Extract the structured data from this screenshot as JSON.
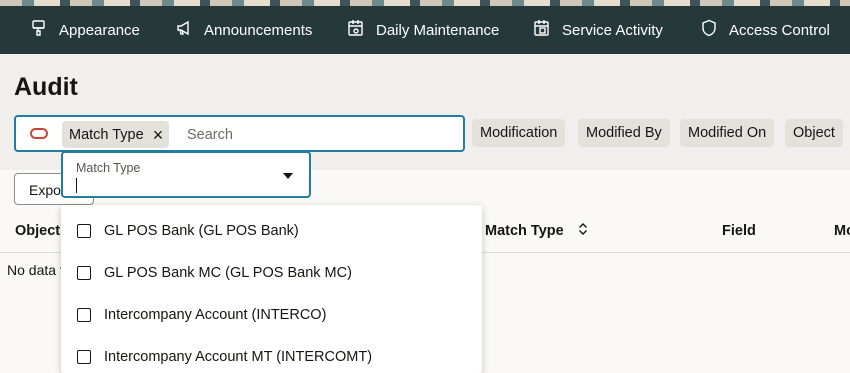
{
  "nav": {
    "items": [
      {
        "label": "Appearance",
        "icon": "brush-icon"
      },
      {
        "label": "Announcements",
        "icon": "megaphone-icon"
      },
      {
        "label": "Daily Maintenance",
        "icon": "calendar-gear-icon"
      },
      {
        "label": "Service Activity",
        "icon": "calendar-clipboard-icon"
      },
      {
        "label": "Access Control",
        "icon": "shield-icon"
      }
    ]
  },
  "page": {
    "title": "Audit"
  },
  "search": {
    "chip_label": "Match Type",
    "chip_remove": "×",
    "placeholder": "Search",
    "value": ""
  },
  "filters": {
    "pills": [
      "Modification",
      "Modified By",
      "Modified On",
      "Object"
    ]
  },
  "toolbar": {
    "export_label": "Export"
  },
  "table": {
    "headers": [
      "Object",
      "Match Type",
      "Field",
      "Mo"
    ],
    "empty_text": "No data to display."
  },
  "dropdown": {
    "label": "Match Type",
    "value": "",
    "options": [
      {
        "label": "GL POS Bank (GL POS Bank)",
        "checked": false
      },
      {
        "label": "GL POS Bank MC (GL POS Bank MC)",
        "checked": false
      },
      {
        "label": "Intercompany Account (INTERCO)",
        "checked": false
      },
      {
        "label": "Intercompany Account MT (INTERCOMT)",
        "checked": false
      }
    ]
  },
  "colors": {
    "nav_bg": "#25393b",
    "focus_border": "#227e9e",
    "filter_icon": "#c74634",
    "pill_bg": "#e4e1dd"
  }
}
